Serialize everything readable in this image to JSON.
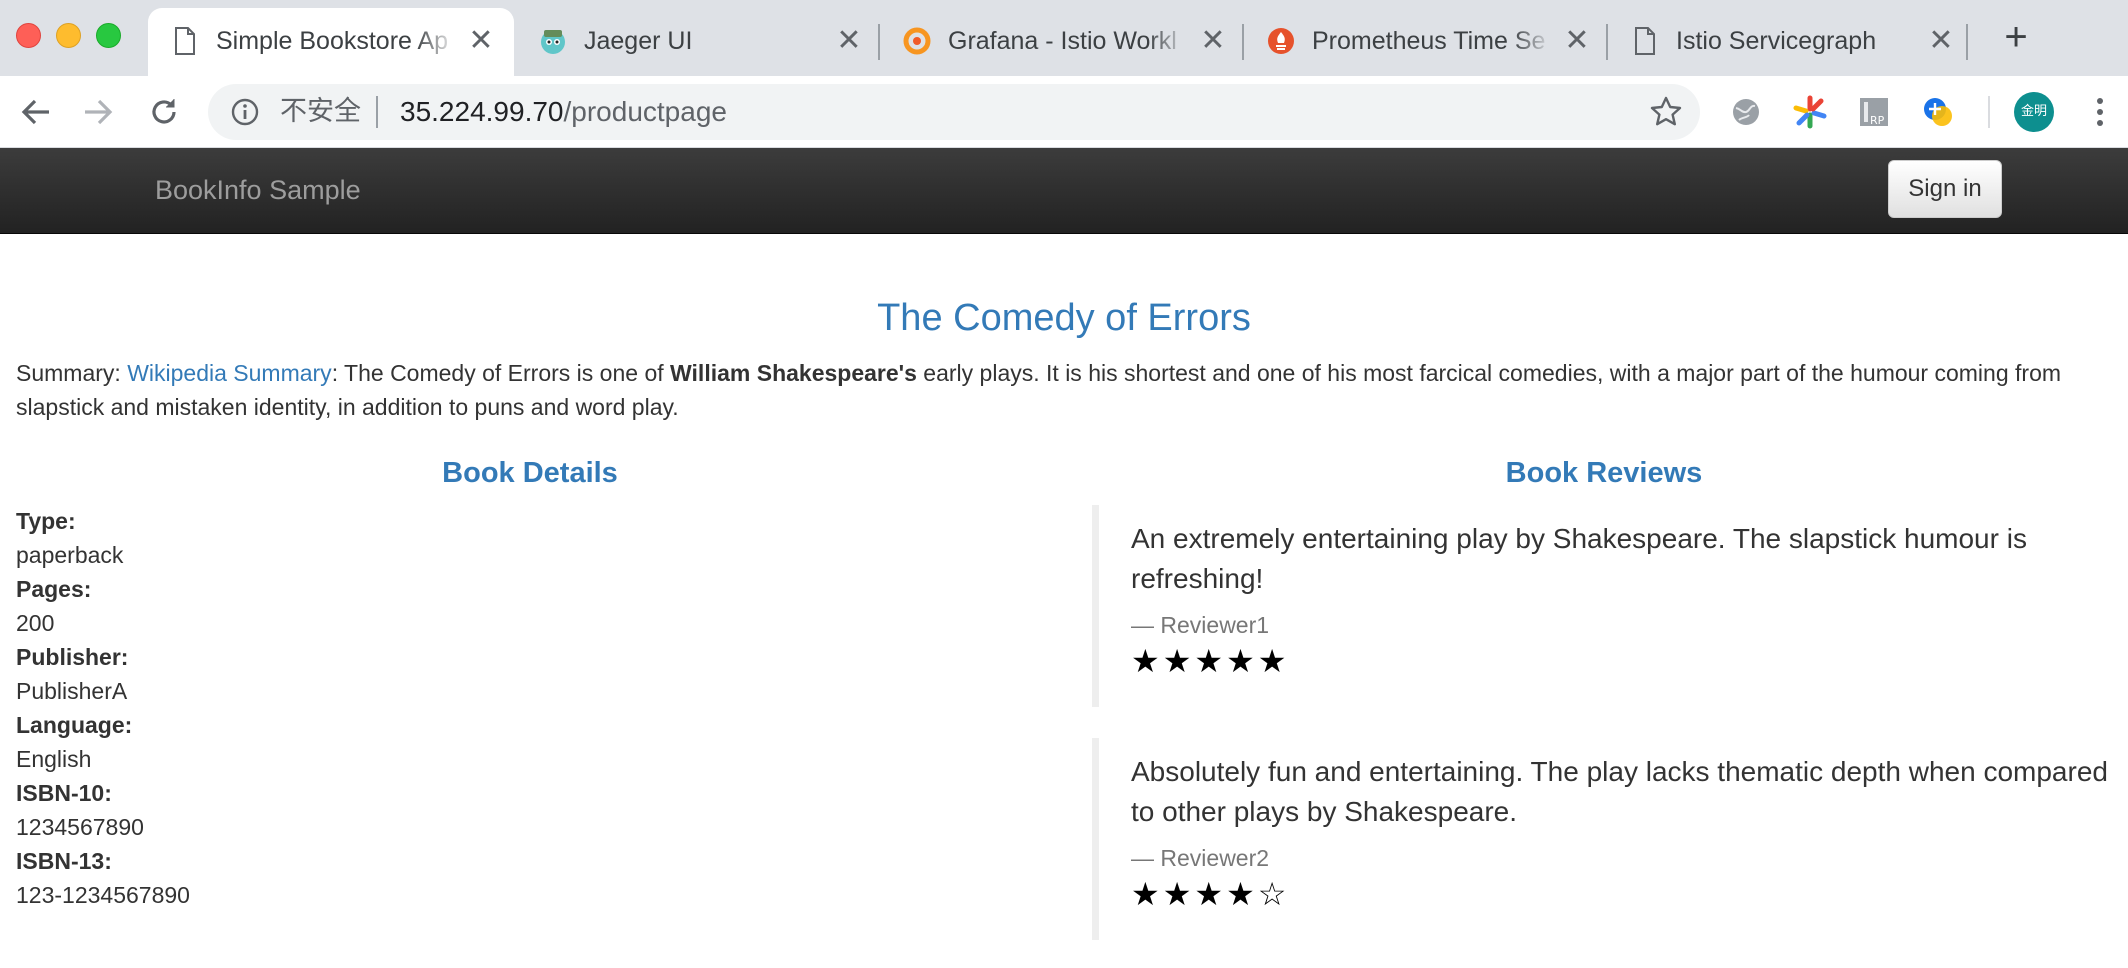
{
  "browser": {
    "tabs": [
      {
        "title": "Simple Bookstore Ap",
        "favicon": "page-icon",
        "active": true
      },
      {
        "title": "Jaeger UI",
        "favicon": "jaeger-icon",
        "active": false
      },
      {
        "title": "Grafana - Istio Workl",
        "favicon": "grafana-icon",
        "active": false
      },
      {
        "title": "Prometheus Time Se",
        "favicon": "prometheus-icon",
        "active": false
      },
      {
        "title": "Istio Servicegraph",
        "favicon": "page-icon",
        "active": false
      }
    ],
    "new_tab_label": "+",
    "omnibox": {
      "insecure_label": "不安全",
      "host": "35.224.99.70",
      "path": "/productpage"
    },
    "avatar_label": "金明",
    "colors": {
      "tabstrip": "#dee1e6",
      "avatar": "#0d8f8f"
    }
  },
  "navbar": {
    "brand": "BookInfo Sample",
    "signin_label": "Sign in"
  },
  "book": {
    "title": "The Comedy of Errors",
    "summary_prefix": "Summary: ",
    "summary_link": "Wikipedia Summary",
    "summary_text_1": ": The Comedy of Errors is one of ",
    "summary_bold": "William Shakespeare's",
    "summary_text_2": " early plays. It is his shortest and one of his most farcical comedies, with a major part of the humour coming from slapstick and mistaken identity, in addition to puns and word play."
  },
  "details": {
    "heading": "Book Details",
    "items": [
      {
        "label": "Type:",
        "value": "paperback"
      },
      {
        "label": "Pages:",
        "value": "200"
      },
      {
        "label": "Publisher:",
        "value": "PublisherA"
      },
      {
        "label": "Language:",
        "value": "English"
      },
      {
        "label": "ISBN-10:",
        "value": "1234567890"
      },
      {
        "label": "ISBN-13:",
        "value": "123-1234567890"
      }
    ]
  },
  "reviews": {
    "heading": "Book Reviews",
    "items": [
      {
        "text": "An extremely entertaining play by Shakespeare. The slapstick humour is refreshing!",
        "reviewer": "— Reviewer1",
        "stars": "★★★★★",
        "rating": 5
      },
      {
        "text": "Absolutely fun and entertaining. The play lacks thematic depth when compared to other plays by Shakespeare.",
        "reviewer": "— Reviewer2",
        "stars": "★★★★☆",
        "rating": 4
      }
    ],
    "link_color": "#337ab7"
  }
}
